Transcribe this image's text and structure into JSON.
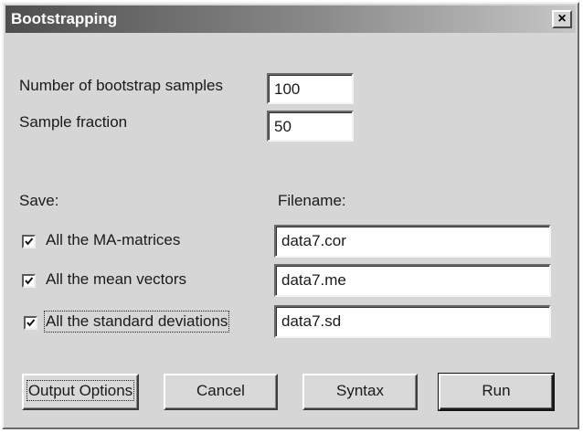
{
  "window": {
    "title": "Bootstrapping",
    "close_glyph": "✕",
    "close_icon": "close-icon"
  },
  "settings": {
    "samples_label": "Number of bootstrap samples",
    "samples_value": "100",
    "fraction_label": "Sample fraction",
    "fraction_value": "50"
  },
  "save": {
    "save_label": "Save:",
    "filename_label": "Filename:",
    "items": [
      {
        "label": "All the MA-matrices",
        "checked": true,
        "filename": "data7.cor"
      },
      {
        "label": "All the mean vectors",
        "checked": true,
        "filename": "data7.me"
      },
      {
        "label": "All the standard deviations",
        "checked": true,
        "filename": "data7.sd"
      }
    ]
  },
  "buttons": {
    "output_options": "Output Options",
    "cancel": "Cancel",
    "syntax": "Syntax",
    "run": "Run"
  }
}
